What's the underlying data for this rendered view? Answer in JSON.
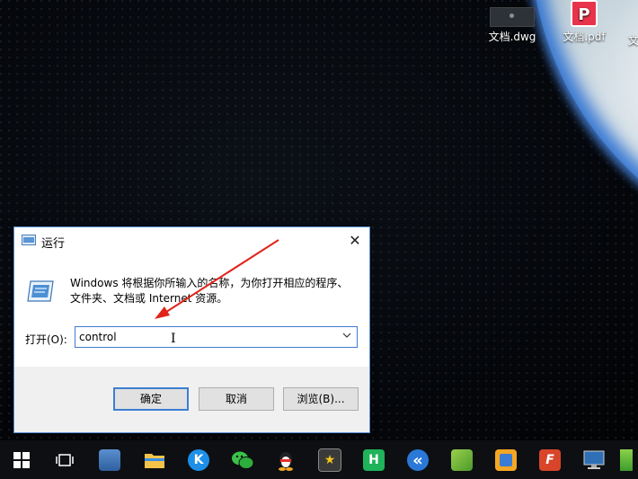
{
  "desktop": {
    "icons": [
      {
        "label": "文档.dwg"
      },
      {
        "label": "文档.pdf"
      },
      {
        "label": "文"
      }
    ]
  },
  "run_dialog": {
    "title": "运行",
    "close_glyph": "✕",
    "description_line1": "Windows 将根据你所输入的名称，为你打开相应的程序、",
    "description_line2": "文件夹、文档或 Internet 资源。",
    "open_label": "打开(O):",
    "open_value": "control",
    "buttons": {
      "ok": "确定",
      "cancel": "取消",
      "browse": "浏览(B)..."
    }
  },
  "annotation": {
    "arrow_color": "#e0241b"
  },
  "taskbar": {
    "items": [
      {
        "name": "start",
        "icon": "windows-logo-icon"
      },
      {
        "name": "task-view",
        "icon": "task-view-icon"
      },
      {
        "name": "network-settings",
        "icon": "network-computer-icon"
      },
      {
        "name": "file-explorer",
        "icon": "folder-icon"
      },
      {
        "name": "kugou",
        "icon": "k-music-icon",
        "glyph": "K"
      },
      {
        "name": "wechat",
        "icon": "wechat-icon"
      },
      {
        "name": "qq",
        "icon": "qq-penguin-icon"
      },
      {
        "name": "app-dark",
        "icon": "star-app-icon",
        "glyph": "★"
      },
      {
        "name": "hbuilder",
        "icon": "h-editor-icon",
        "glyph": "H"
      },
      {
        "name": "kuaiya",
        "icon": "double-chevron-icon",
        "glyph": "«"
      },
      {
        "name": "app-green",
        "icon": "green-app-icon"
      },
      {
        "name": "app-orange",
        "icon": "orange-frame-icon"
      },
      {
        "name": "app-f",
        "icon": "f-app-icon",
        "glyph": "F"
      },
      {
        "name": "remote-desktop",
        "icon": "monitor-icon"
      },
      {
        "name": "app-partial",
        "icon": "green-tile-icon"
      }
    ]
  }
}
